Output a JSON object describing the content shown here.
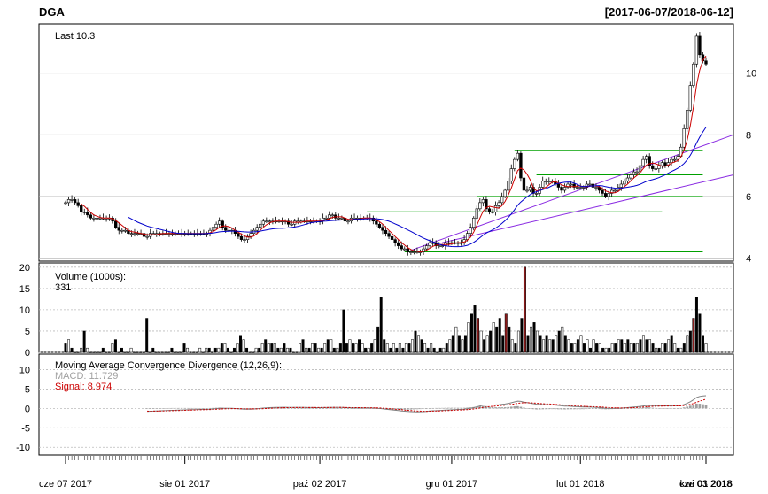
{
  "header": {
    "symbol": "DGA",
    "date_range": "[2017-06-07/2018-06-12]"
  },
  "colors": {
    "up": "#ffffff",
    "down": "#000000",
    "highlight": "#8b1a1a",
    "sma_fast": "#cc0000",
    "sma_slow": "#0000cc",
    "trendline": "#8a2be2",
    "levels": "#00a000",
    "macd": "#808080",
    "signal": "#cc0000",
    "grid": "#bbbbbb"
  },
  "chart_data": [
    {
      "type": "candlestick",
      "label": "Last 10.3",
      "ylim": [
        3.9,
        11.6
      ],
      "yticks": [
        4,
        6,
        8,
        10
      ],
      "closes": [
        5.8,
        5.9,
        5.9,
        5.8,
        5.7,
        5.5,
        5.5,
        5.4,
        5.3,
        5.3,
        5.3,
        5.3,
        5.3,
        5.3,
        5.3,
        5.2,
        5.0,
        4.9,
        4.9,
        4.9,
        4.8,
        4.8,
        4.8,
        4.8,
        4.8,
        4.7,
        4.7,
        4.8,
        4.8,
        4.8,
        4.8,
        4.8,
        4.8,
        4.8,
        4.8,
        4.8,
        4.8,
        4.8,
        4.8,
        4.8,
        4.8,
        4.8,
        4.8,
        4.8,
        4.8,
        4.8,
        4.9,
        5.0,
        5.1,
        5.2,
        5.0,
        4.9,
        4.9,
        4.9,
        4.8,
        4.7,
        4.6,
        4.6,
        4.7,
        4.8,
        4.9,
        5.0,
        5.1,
        5.2,
        5.2,
        5.2,
        5.2,
        5.2,
        5.2,
        5.2,
        5.2,
        5.1,
        5.1,
        5.2,
        5.2,
        5.2,
        5.2,
        5.2,
        5.2,
        5.2,
        5.2,
        5.2,
        5.3,
        5.3,
        5.4,
        5.4,
        5.3,
        5.3,
        5.3,
        5.2,
        5.2,
        5.3,
        5.3,
        5.3,
        5.3,
        5.3,
        5.3,
        5.3,
        5.2,
        5.1,
        5.0,
        4.9,
        4.8,
        4.7,
        4.6,
        4.5,
        4.4,
        4.3,
        4.3,
        4.2,
        4.2,
        4.2,
        4.2,
        4.2,
        4.3,
        4.4,
        4.5,
        4.5,
        4.4,
        4.4,
        4.4,
        4.5,
        4.5,
        4.5,
        4.5,
        4.5,
        4.5,
        4.6,
        4.8,
        5.0,
        5.3,
        5.6,
        5.8,
        5.9,
        5.6,
        5.5,
        5.5,
        5.7,
        5.8,
        6.0,
        6.2,
        6.5,
        6.9,
        7.2,
        7.4,
        6.6,
        6.2,
        6.2,
        6.3,
        6.1,
        6.1,
        6.3,
        6.5,
        6.5,
        6.5,
        6.5,
        6.4,
        6.3,
        6.2,
        6.3,
        6.4,
        6.4,
        6.3,
        6.3,
        6.3,
        6.3,
        6.4,
        6.4,
        6.3,
        6.3,
        6.2,
        6.1,
        6.0,
        6.1,
        6.2,
        6.2,
        6.3,
        6.4,
        6.5,
        6.6,
        6.7,
        6.8,
        6.8,
        7.0,
        7.2,
        7.3,
        7.0,
        6.9,
        6.9,
        7.0,
        7.1,
        7.0,
        7.1,
        7.2,
        7.2,
        7.3,
        7.6,
        8.2,
        8.8,
        9.6,
        10.3,
        11.2,
        10.6,
        10.4,
        10.3
      ]
    },
    {
      "type": "bar",
      "label": "Volume (1000s):",
      "last_value": "331",
      "ylim": [
        0,
        21
      ],
      "yticks": [
        0,
        5,
        10,
        15,
        20
      ],
      "values": [
        2,
        3,
        1,
        0,
        0,
        1,
        5,
        1,
        0,
        0,
        0,
        0,
        1,
        0,
        0,
        2,
        3,
        0,
        1,
        0,
        0,
        1,
        0,
        0,
        0,
        0,
        8,
        0,
        1,
        0,
        0,
        0,
        0,
        0,
        1,
        0,
        0,
        0,
        2,
        1,
        0,
        0,
        0,
        1,
        0,
        1,
        1,
        0,
        1,
        1,
        2,
        2,
        1,
        0,
        1,
        2,
        4,
        3,
        1,
        0,
        0,
        1,
        1,
        2,
        3,
        2,
        2,
        2,
        1,
        1,
        2,
        1,
        1,
        0,
        0,
        2,
        3,
        1,
        1,
        2,
        2,
        1,
        1,
        2,
        3,
        3,
        1,
        1,
        2,
        10,
        2,
        3,
        2,
        2,
        3,
        2,
        1,
        1,
        2,
        3,
        6,
        13,
        3,
        2,
        1,
        2,
        1,
        2,
        1,
        2,
        2,
        3,
        5,
        4,
        3,
        2,
        1,
        2,
        1,
        0,
        1,
        1,
        2,
        3,
        4,
        6,
        4,
        3,
        4,
        7,
        9,
        11,
        8,
        5,
        3,
        4,
        5,
        7,
        6,
        8,
        4,
        9,
        6,
        3,
        2,
        5,
        8,
        20,
        4,
        6,
        7,
        5,
        4,
        3,
        4,
        3,
        3,
        4,
        5,
        6,
        4,
        3,
        2,
        2,
        3,
        4,
        2,
        3,
        1,
        3,
        2,
        2,
        1,
        1,
        1,
        2,
        2,
        3,
        3,
        2,
        3,
        2,
        2,
        2,
        3,
        4,
        3,
        3,
        2,
        1,
        1,
        2,
        2,
        3,
        4,
        2,
        1,
        1,
        2,
        4,
        5,
        8,
        13,
        9,
        4,
        2
      ]
    },
    {
      "type": "line",
      "label": "Moving Average Convergence Divergence (12,26,9):",
      "macd_label": "MACD: 11.729",
      "signal_label": "Signal: 8.974",
      "ylim": [
        -12,
        14
      ],
      "yticks": [
        -10,
        -5,
        0,
        5,
        10
      ],
      "x_labels": [
        "cze 07 2017",
        "sie 01 2017",
        "paź 02 2017",
        "gru 01 2017",
        "lut 01 2018",
        "kwi 03 2018",
        "cze 01 2018"
      ]
    }
  ]
}
